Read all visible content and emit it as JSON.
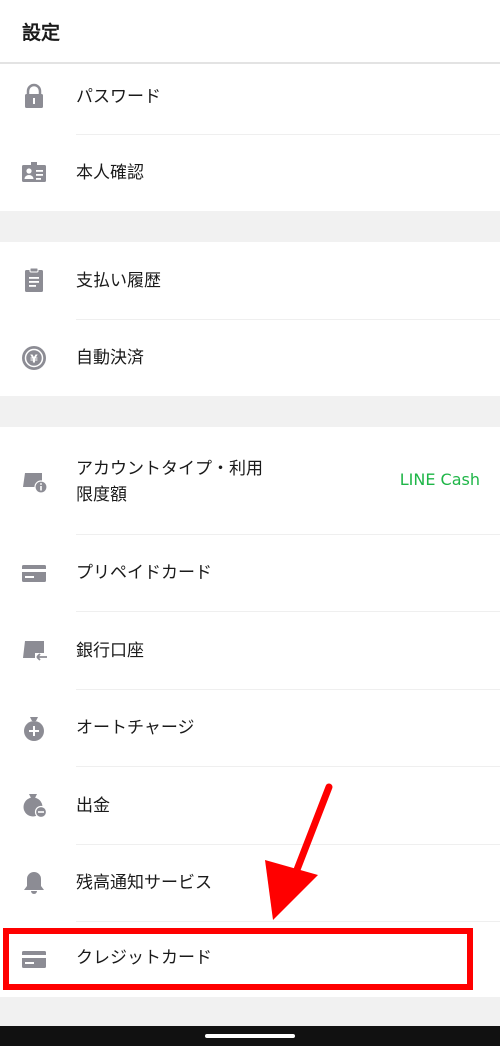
{
  "header": {
    "title": "設定"
  },
  "items": [
    {
      "label": "パスワード",
      "icon": "lock-icon"
    },
    {
      "label": "本人確認",
      "icon": "id-card-icon"
    },
    {
      "label": "支払い履歴",
      "icon": "clipboard-icon"
    },
    {
      "label": "自動決済",
      "icon": "yen-coin-icon"
    },
    {
      "label_line1": "アカウントタイプ・利用",
      "label_line2": "限度額",
      "value": "LINE Cash",
      "icon": "account-limit-icon"
    },
    {
      "label": "プリペイドカード",
      "icon": "prepaid-card-icon"
    },
    {
      "label": "銀行口座",
      "icon": "bank-account-icon"
    },
    {
      "label": "オートチャージ",
      "icon": "auto-charge-bag-icon"
    },
    {
      "label": "出金",
      "icon": "withdraw-bag-icon"
    },
    {
      "label": "残高通知サービス",
      "icon": "bell-icon"
    },
    {
      "label": "クレジットカード",
      "icon": "credit-card-icon"
    }
  ],
  "colors": {
    "icon_gray": "#8c8c94",
    "accent_green": "#1fb648",
    "highlight_red": "#ff0000",
    "section_gap": "#f1f1f1"
  }
}
